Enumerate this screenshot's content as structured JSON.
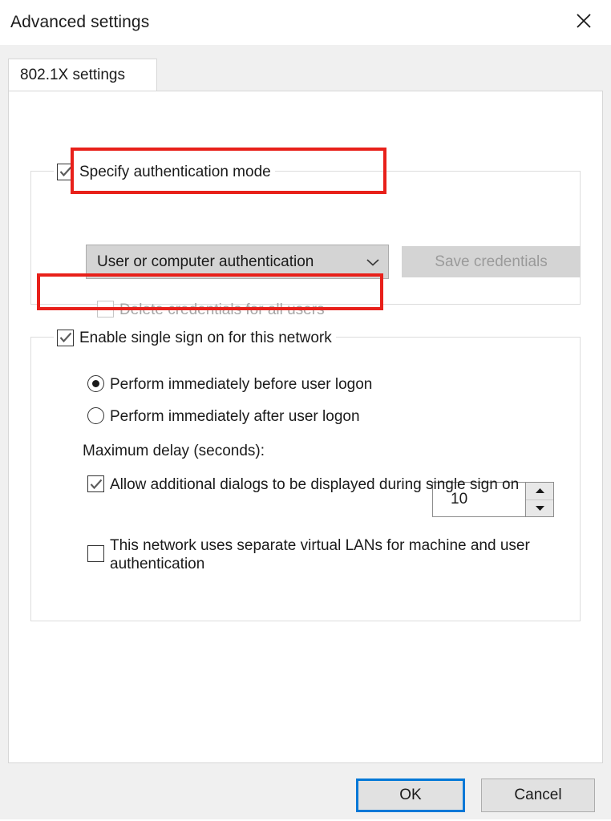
{
  "window": {
    "title": "Advanced settings",
    "close_icon": "close-icon"
  },
  "tab": {
    "label": "802.1X settings"
  },
  "auth_group": {
    "checkbox_label": "Specify authentication mode",
    "checkbox_checked": true,
    "mode_combo": {
      "value": "User or computer authentication",
      "arrow_icon": "chevron-down-icon",
      "highlighted": true
    },
    "save_credentials_button": {
      "label": "Save credentials",
      "enabled": false
    },
    "delete_credentials_checkbox": {
      "label": "Delete credentials for all users",
      "checked": false,
      "enabled": false
    }
  },
  "sso_group": {
    "checkbox_label": "Enable single sign on for this network",
    "checkbox_checked": true,
    "highlighted": true,
    "radio_before": {
      "label": "Perform immediately before user logon",
      "selected": true
    },
    "radio_after": {
      "label": "Perform immediately after user logon",
      "selected": false
    },
    "max_delay": {
      "label": "Maximum delay (seconds):",
      "value": "10",
      "up_icon": "triangle-up-icon",
      "down_icon": "triangle-down-icon"
    },
    "allow_dialogs_checkbox": {
      "label": "Allow additional dialogs to be displayed during single sign on",
      "checked": true
    },
    "vlan_checkbox": {
      "label": "This network uses separate virtual LANs for machine and user authentication",
      "checked": false
    }
  },
  "footer": {
    "ok_label": "OK",
    "cancel_label": "Cancel"
  },
  "colors": {
    "annotation": "#e8201a",
    "focus": "#0078d7"
  }
}
